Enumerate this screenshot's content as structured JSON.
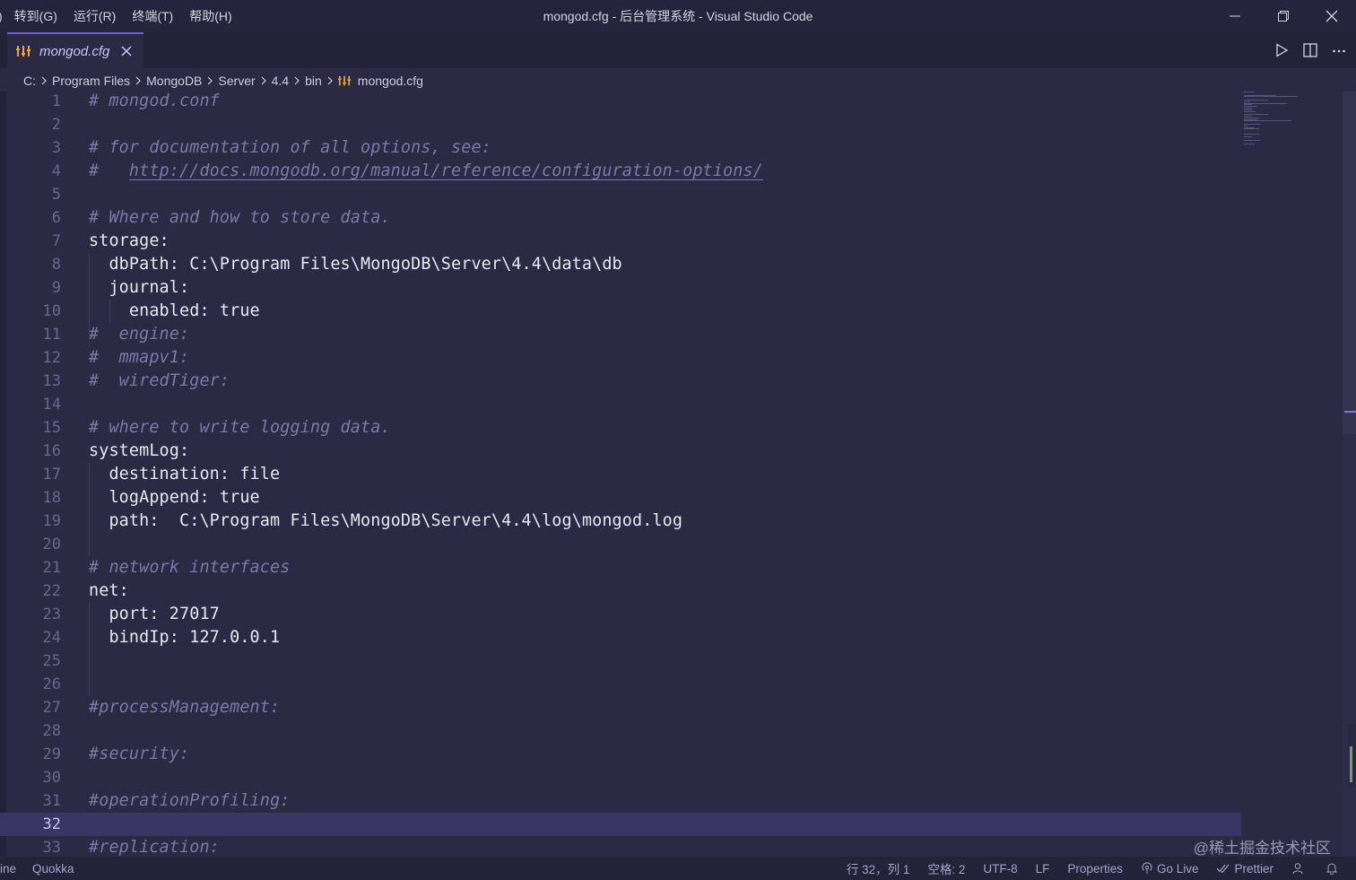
{
  "titlebar": {
    "menu": [
      "转到(G)",
      "运行(R)",
      "终端(T)",
      "帮助(H)"
    ],
    "title": "mongod.cfg - 后台管理系统 - Visual Studio Code"
  },
  "tab": {
    "label": "mongod.cfg",
    "icon": "config-file-icon"
  },
  "breadcrumb": [
    "C:",
    "Program Files",
    "MongoDB",
    "Server",
    "4.4",
    "bin",
    "mongod.cfg"
  ],
  "editor": {
    "current_line": 32,
    "lines": [
      {
        "n": "1",
        "text": "# mongod.conf",
        "type": "comment"
      },
      {
        "n": "2",
        "text": "",
        "type": "blank"
      },
      {
        "n": "3",
        "text": "# for documentation of all options, see:",
        "type": "comment"
      },
      {
        "n": "4",
        "text": "#   ",
        "type": "comment",
        "url": "http://docs.mongodb.org/manual/reference/configuration-options/"
      },
      {
        "n": "5",
        "text": "",
        "type": "blank"
      },
      {
        "n": "6",
        "text": "# Where and how to store data.",
        "type": "comment"
      },
      {
        "n": "7",
        "text": "storage:",
        "type": "code"
      },
      {
        "n": "8",
        "text": "  dbPath: C:\\Program Files\\MongoDB\\Server\\4.4\\data\\db",
        "type": "code"
      },
      {
        "n": "9",
        "text": "  journal:",
        "type": "code"
      },
      {
        "n": "10",
        "text": "    enabled: true",
        "type": "code"
      },
      {
        "n": "11",
        "text": "#  engine:",
        "type": "comment"
      },
      {
        "n": "12",
        "text": "#  mmapv1:",
        "type": "comment"
      },
      {
        "n": "13",
        "text": "#  wiredTiger:",
        "type": "comment"
      },
      {
        "n": "14",
        "text": "",
        "type": "blank"
      },
      {
        "n": "15",
        "text": "# where to write logging data.",
        "type": "comment"
      },
      {
        "n": "16",
        "text": "systemLog:",
        "type": "code"
      },
      {
        "n": "17",
        "text": "  destination: file",
        "type": "code"
      },
      {
        "n": "18",
        "text": "  logAppend: true",
        "type": "code"
      },
      {
        "n": "19",
        "text": "  path:  C:\\Program Files\\MongoDB\\Server\\4.4\\log\\mongod.log",
        "type": "code"
      },
      {
        "n": "20",
        "text": "",
        "type": "blank"
      },
      {
        "n": "21",
        "text": "# network interfaces",
        "type": "comment"
      },
      {
        "n": "22",
        "text": "net:",
        "type": "code"
      },
      {
        "n": "23",
        "text": "  port: 27017",
        "type": "code"
      },
      {
        "n": "24",
        "text": "  bindIp: 127.0.0.1",
        "type": "code"
      },
      {
        "n": "25",
        "text": "",
        "type": "blank"
      },
      {
        "n": "26",
        "text": "",
        "type": "blank"
      },
      {
        "n": "27",
        "text": "#processManagement:",
        "type": "comment"
      },
      {
        "n": "28",
        "text": "",
        "type": "blank"
      },
      {
        "n": "29",
        "text": "#security:",
        "type": "comment"
      },
      {
        "n": "30",
        "text": "",
        "type": "blank"
      },
      {
        "n": "31",
        "text": "#operationProfiling:",
        "type": "comment"
      },
      {
        "n": "32",
        "text": "",
        "type": "blank"
      },
      {
        "n": "33",
        "text": "#replication:",
        "type": "comment"
      }
    ]
  },
  "watermark": "@稀土掘金技术社区",
  "statusbar": {
    "left": [
      "line",
      "Quokka"
    ],
    "cursor": "行 32，列 1",
    "spaces": "空格: 2",
    "encoding": "UTF-8",
    "eol": "LF",
    "language": "Properties",
    "golive": "Go Live",
    "prettier": "Prettier"
  },
  "colors": {
    "background": "#2b2944",
    "accent": "#6e62c9",
    "comment": "#7d7aa6",
    "icon": "#e8a33d"
  }
}
